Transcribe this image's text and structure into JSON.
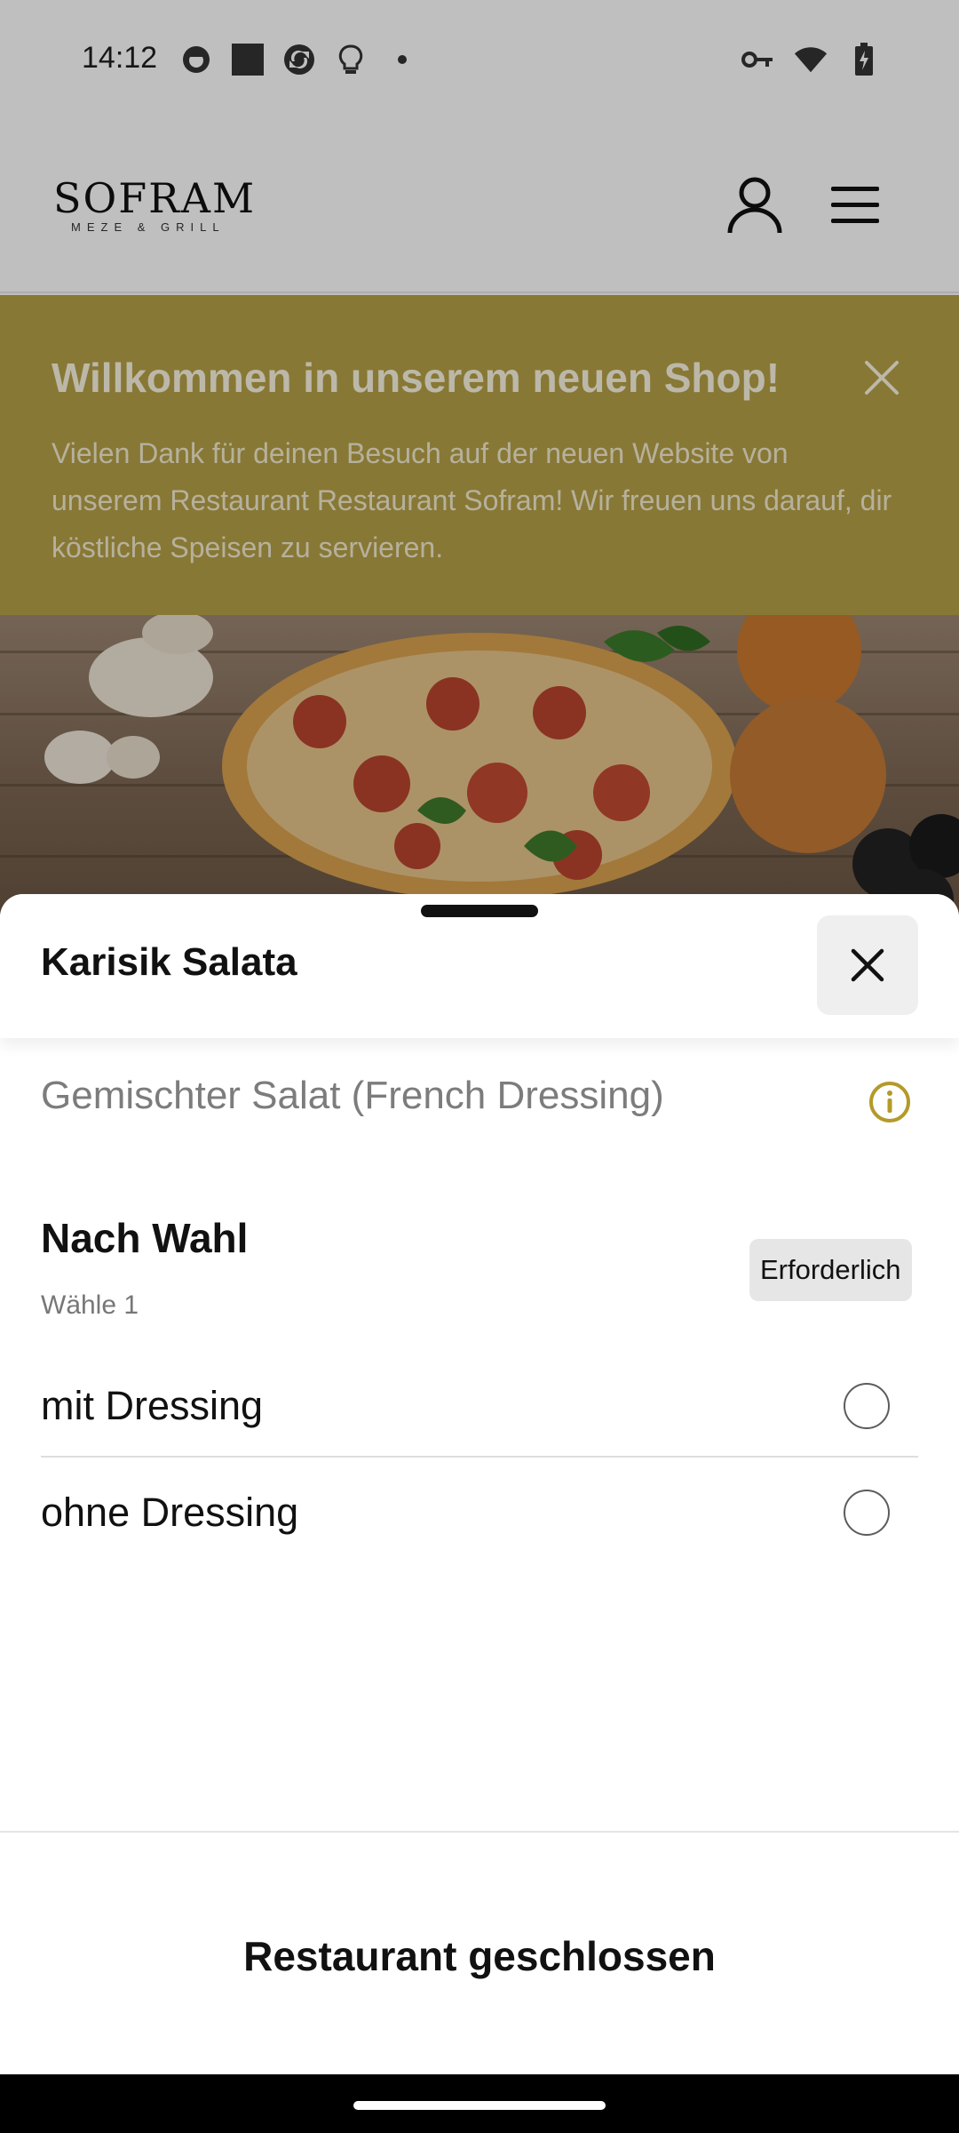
{
  "status_bar": {
    "time": "14:12",
    "left_icons": [
      "app-notification-icon",
      "square-app-icon",
      "sync-app-icon",
      "lightbulb-icon",
      "more-dot-icon"
    ],
    "right_icons": [
      "vpn-key-icon",
      "wifi-icon",
      "battery-charging-icon"
    ]
  },
  "header": {
    "logo_main": "SOFRAM",
    "logo_sub": "MEZE & GRILL",
    "user_icon": "account-icon",
    "menu_icon": "hamburger-menu-icon"
  },
  "banner": {
    "title": "Willkommen in unserem neuen Shop!",
    "text": "Vielen Dank für deinen Besuch auf der neuen Website von unserem Restaurant Restaurant Sofram! Wir freuen uns darauf, dir köstliche Speisen zu servieren.",
    "color": "#b6a047"
  },
  "sheet": {
    "title": "Karisik Salata",
    "description": "Gemischter Salat (French Dressing)",
    "group": {
      "title": "Nach Wahl",
      "subtitle": "Wähle 1",
      "badge": "Erforderlich",
      "options": [
        {
          "label": "mit Dressing",
          "selected": false
        },
        {
          "label": "ohne Dressing",
          "selected": false
        }
      ]
    },
    "footer": "Restaurant geschlossen"
  },
  "colors": {
    "accent_gold": "#b6a047",
    "info_icon": "#b39a2a"
  }
}
